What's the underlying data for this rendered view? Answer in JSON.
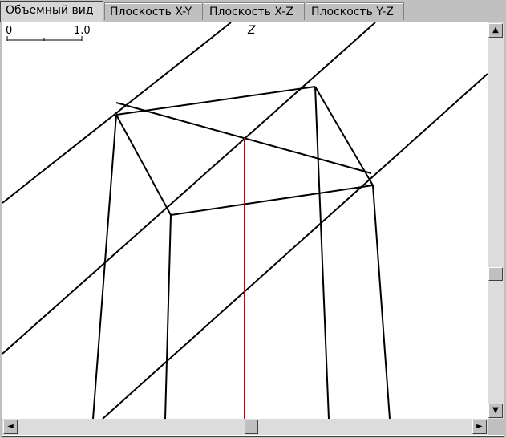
{
  "tabs": [
    {
      "label": "Объемный вид",
      "active": true
    },
    {
      "label": "Плоскость X-Y",
      "active": false
    },
    {
      "label": "Плоскость  X-Z",
      "active": false
    },
    {
      "label": "Плоскость Y-Z",
      "active": false
    }
  ],
  "scale": {
    "start": "0",
    "end": "1.0"
  },
  "axis": {
    "label": "Z"
  },
  "scrollbars": {
    "up_arrow": "▲",
    "down_arrow": "▼",
    "left_arrow": "◄",
    "right_arrow": "►"
  },
  "colors": {
    "axis_line": "#d00000",
    "model_lines": "#000000"
  }
}
